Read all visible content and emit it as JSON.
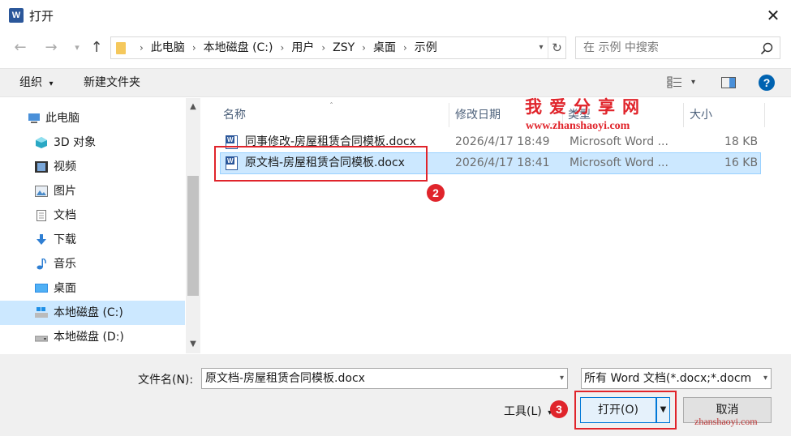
{
  "window": {
    "title": "打开",
    "app_icon": "word-app-icon",
    "close_label": "✕"
  },
  "address_bar": {
    "crumbs": [
      "此电脑",
      "本地磁盘 (C:)",
      "用户",
      "ZSY",
      "桌面",
      "示例"
    ],
    "search_placeholder": "在 示例 中搜索"
  },
  "toolbar": {
    "organize_label": "组织",
    "new_folder_label": "新建文件夹"
  },
  "nav_pane": {
    "items": [
      {
        "label": "此电脑",
        "icon": "computer-icon"
      },
      {
        "label": "3D 对象",
        "icon": "cube-3d-icon"
      },
      {
        "label": "视频",
        "icon": "video-icon"
      },
      {
        "label": "图片",
        "icon": "picture-icon"
      },
      {
        "label": "文档",
        "icon": "document-icon"
      },
      {
        "label": "下载",
        "icon": "download-icon"
      },
      {
        "label": "音乐",
        "icon": "music-icon"
      },
      {
        "label": "桌面",
        "icon": "desktop-icon"
      },
      {
        "label": "本地磁盘 (C:)",
        "icon": "drive-c-icon",
        "selected": true
      },
      {
        "label": "本地磁盘 (D:)",
        "icon": "drive-d-icon"
      }
    ]
  },
  "file_list": {
    "columns": {
      "name": "名称",
      "modified": "修改日期",
      "type": "类型",
      "size": "大小"
    },
    "rows": [
      {
        "name": "同事修改-房屋租赁合同模板.docx",
        "modified": "2026/4/17 18:49",
        "type": "Microsoft Word ...",
        "size": "18 KB",
        "selected": false
      },
      {
        "name": "原文档-房屋租赁合同模板.docx",
        "modified": "2026/4/17 18:41",
        "type": "Microsoft Word ...",
        "size": "16 KB",
        "selected": true
      }
    ]
  },
  "bottom": {
    "filename_label": "文件名(N):",
    "filename_value": "原文档-房屋租赁合同模板.docx",
    "filetype_value": "所有 Word 文档(*.docx;*.docm",
    "tools_label": "工具(L)",
    "open_label": "打开(O)",
    "cancel_label": "取消"
  },
  "annotations": {
    "badge_2": "2",
    "badge_3": "3",
    "watermark_title": "我爱分享网",
    "watermark_url": "www.zhanshaoyi.com",
    "watermark_bottom": "zhanshaoyi.com",
    "highlight_color": "#e0242b"
  },
  "colors": {
    "selection": "#cce8ff",
    "accent": "#0078d7",
    "word_blue": "#2b579a"
  }
}
